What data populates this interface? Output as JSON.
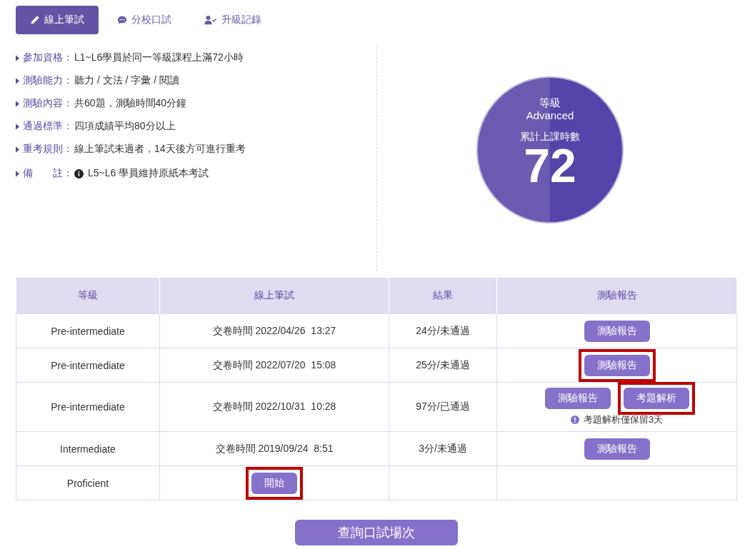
{
  "tabs": [
    {
      "label": "線上筆試",
      "selected": true
    },
    {
      "label": "分校口試",
      "selected": false
    },
    {
      "label": "升級記錄",
      "selected": false
    }
  ],
  "info": [
    {
      "kind": "plain",
      "label": "參加資格：",
      "text": "L1~L6學員於同一等級課程上滿72小時"
    },
    {
      "kind": "plain",
      "label": "測驗能力：",
      "text": "聽力 / 文法 / 字彙 / 閱讀"
    },
    {
      "kind": "plain",
      "label": "測驗內容：",
      "text": "共60題，測驗時間40分鐘"
    },
    {
      "kind": "plain",
      "label": "通過標準：",
      "text": "四項成績平均80分以上"
    },
    {
      "kind": "plain",
      "label": "重考規則：",
      "text": "線上筆試未過者，14天後方可進行重考"
    },
    {
      "kind": "note",
      "label": "備　　註：",
      "text": "L5~L6 學員維持原紙本考試"
    }
  ],
  "badge": {
    "level_label": "等級",
    "level": "Advanced",
    "hours_label": "累計上課時數",
    "hours": "72"
  },
  "table": {
    "columns": [
      "等級",
      "線上筆試",
      "結果",
      "測驗報告"
    ],
    "rows": [
      {
        "level": "Pre-intermediate",
        "exam": "交卷時間 2022/04/26  13:27",
        "result": "24分/未通過",
        "buttons": [
          {
            "label": "測驗報告",
            "highlighted": false
          }
        ]
      },
      {
        "level": "Pre-intermediate",
        "exam": "交卷時間 2022/07/20  15:08",
        "result": "25分/未通過",
        "buttons": [
          {
            "label": "測驗報告",
            "highlighted": true
          }
        ]
      },
      {
        "level": "Pre-intermediate",
        "exam": "交卷時間 2022/10/31  10:28",
        "result": "97分/已通過",
        "buttons": [
          {
            "label": "測驗報告",
            "highlighted": false
          },
          {
            "label": "考題解析",
            "highlighted": true
          }
        ],
        "note": "考題解析僅保留3天"
      },
      {
        "level": "Intermediate",
        "exam": "交卷時間 2019/09/24  8:51",
        "result": "3分/未通過",
        "buttons": [
          {
            "label": "測驗報告",
            "highlighted": false
          }
        ]
      },
      {
        "level": "Proficient",
        "start_button": {
          "label": "開始",
          "highlighted": true
        }
      }
    ]
  },
  "footer_button": "查詢口試場次"
}
